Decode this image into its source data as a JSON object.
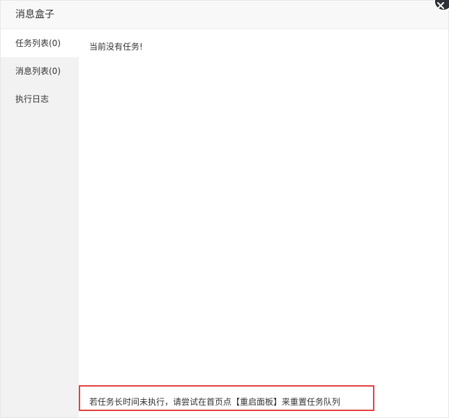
{
  "dialog": {
    "title": "消息盒子",
    "close_icon": "close-icon"
  },
  "sidebar": {
    "items": [
      {
        "label": "任务列表(0)",
        "active": true
      },
      {
        "label": "消息列表(0)",
        "active": false
      },
      {
        "label": "执行日志",
        "active": false
      }
    ]
  },
  "main": {
    "empty_message": "当前没有任务!",
    "tip": "若任务长时间未执行，请尝试在首页点【重启面板】来重置任务队列"
  },
  "colors": {
    "sidebar_bg": "#f2f2f2",
    "title_bar_bg": "#f8f8f8",
    "highlight_border": "#e63e3e",
    "close_button_bg": "#2f3036"
  }
}
